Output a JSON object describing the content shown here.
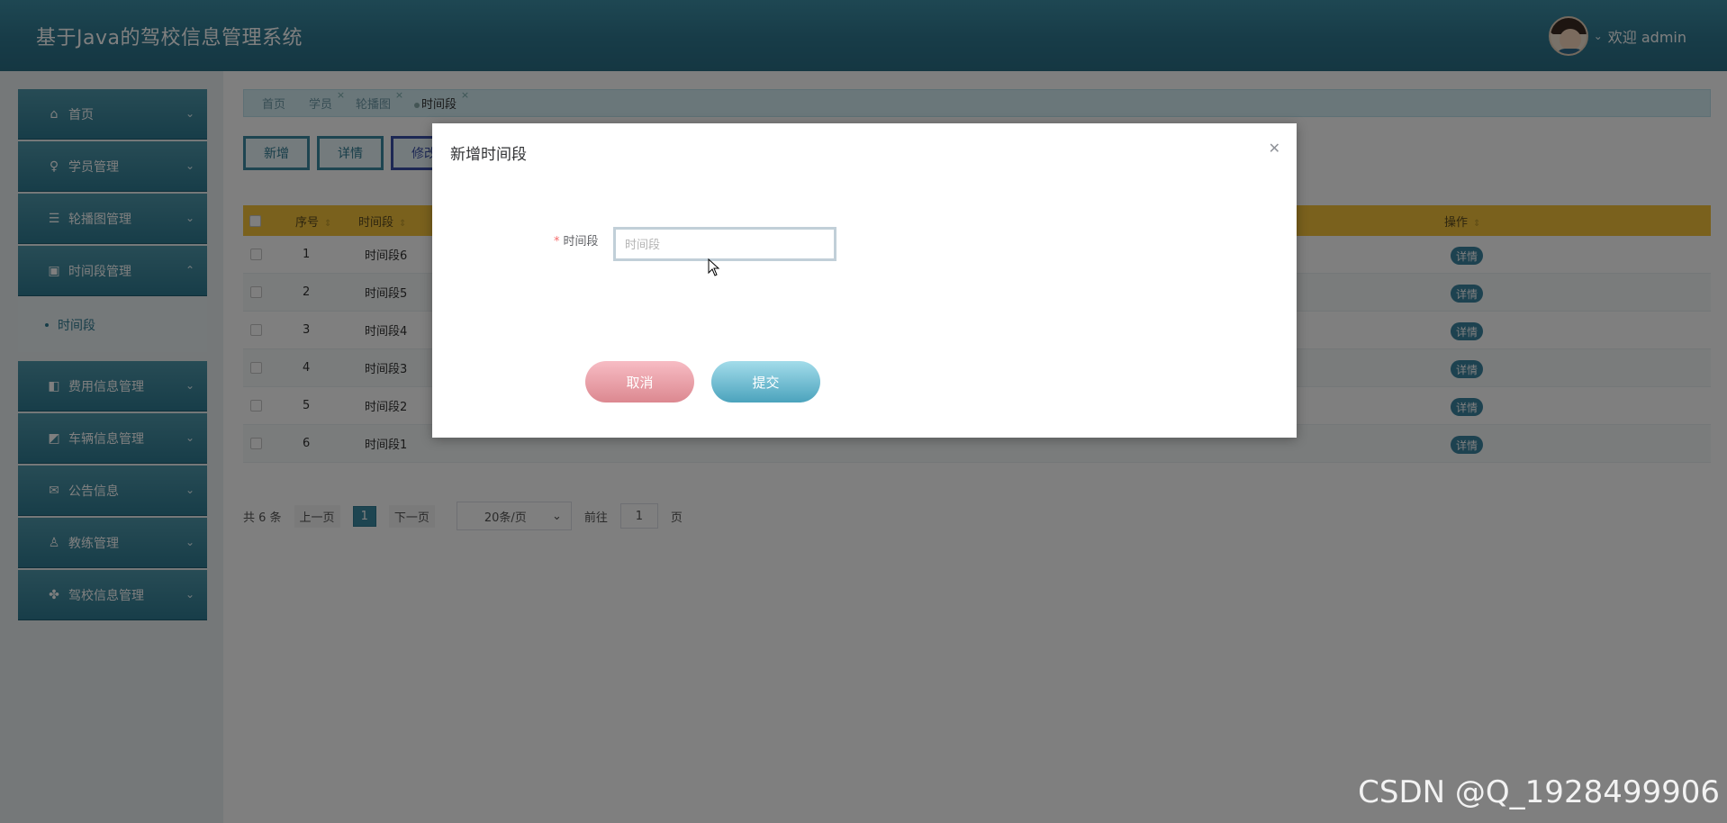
{
  "header": {
    "title": "基于Java的驾校信息管理系统",
    "welcome": "欢迎 admin"
  },
  "sidebar": {
    "items": [
      {
        "label": "首页",
        "icon": "home-icon"
      },
      {
        "label": "学员管理",
        "icon": "student-icon"
      },
      {
        "label": "轮播图管理",
        "icon": "carousel-icon"
      },
      {
        "label": "时间段管理",
        "icon": "clock-icon"
      },
      {
        "label": "费用信息管理",
        "icon": "fee-icon"
      },
      {
        "label": "车辆信息管理",
        "icon": "vehicle-icon"
      },
      {
        "label": "公告信息",
        "icon": "notice-icon"
      },
      {
        "label": "教练管理",
        "icon": "coach-icon"
      },
      {
        "label": "驾校信息管理",
        "icon": "school-icon"
      }
    ],
    "submenu_active": "时间段"
  },
  "tabs": [
    {
      "label": "首页"
    },
    {
      "label": "学员"
    },
    {
      "label": "轮播图"
    },
    {
      "label": "时间段"
    }
  ],
  "toolbar": {
    "add": "新增",
    "detail": "详情",
    "edit": "修改"
  },
  "table": {
    "headers": {
      "no": "序号",
      "time": "时间段",
      "action": "操作"
    },
    "rows": [
      {
        "no": "1",
        "time": "时间段6",
        "action": "详情"
      },
      {
        "no": "2",
        "time": "时间段5",
        "action": "详情"
      },
      {
        "no": "3",
        "time": "时间段4",
        "action": "详情"
      },
      {
        "no": "4",
        "time": "时间段3",
        "action": "详情"
      },
      {
        "no": "5",
        "time": "时间段2",
        "action": "详情"
      },
      {
        "no": "6",
        "time": "时间段1",
        "action": "详情"
      }
    ]
  },
  "pagination": {
    "total": "共 6 条",
    "prev": "上一页",
    "page": "1",
    "next": "下一页",
    "size": "20条/页",
    "goto_prefix": "前往",
    "goto_value": "1",
    "goto_suffix": "页"
  },
  "dialog": {
    "title": "新增时间段",
    "field_label": "时间段",
    "field_placeholder": "时间段",
    "field_value": "",
    "cancel": "取消",
    "submit": "提交"
  },
  "watermark": "CSDN @Q_1928499906"
}
